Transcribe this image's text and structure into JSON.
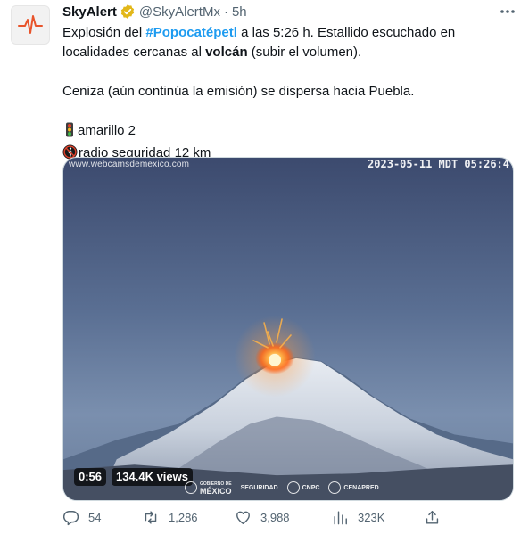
{
  "author": {
    "name": "SkyAlert",
    "handle": "@SkyAlertMx",
    "separator": "·",
    "time": "5h",
    "verified_icon": "gold-verified-badge-icon",
    "avatar_icon": "heartbeat-pulse-icon"
  },
  "tweet": {
    "line1_a": "Explosión del ",
    "hashtag": "#Popocatépetl",
    "line1_b": " a las 5:26 h. Estallido escuchado en localidades cercanas al ",
    "bold_word": "volcán",
    "line1_c": " (subir el volumen).",
    "paragraph2": "Ceniza (aún continúa la emisión) se dispersa hacia Puebla.",
    "alert_level": "amarillo 2",
    "alert_icon": "traffic-light-icon",
    "radius": "radio seguridad 12 km",
    "radius_icon": "no-pedestrians-icon"
  },
  "media": {
    "watermark_site": "www.webcamsdemexico.com",
    "watermark_time": "2023-05-11 MDT 05:26:4",
    "duration": "0:56",
    "views": "134.4K views",
    "logos": {
      "gobierno_small": "GOBIERNO DE",
      "gobierno": "MÉXICO",
      "seguridad": "SEGURIDAD",
      "cnpc": "CNPC",
      "cenapred": "CENAPRED"
    }
  },
  "actions": {
    "replies": "54",
    "retweets": "1,286",
    "likes": "3,988",
    "views": "323K"
  },
  "colors": {
    "accent": "#1d9bf0",
    "secondary_text": "#536471",
    "verified_gold": "#e2b719",
    "avatar_pulse": "#e8542b"
  }
}
